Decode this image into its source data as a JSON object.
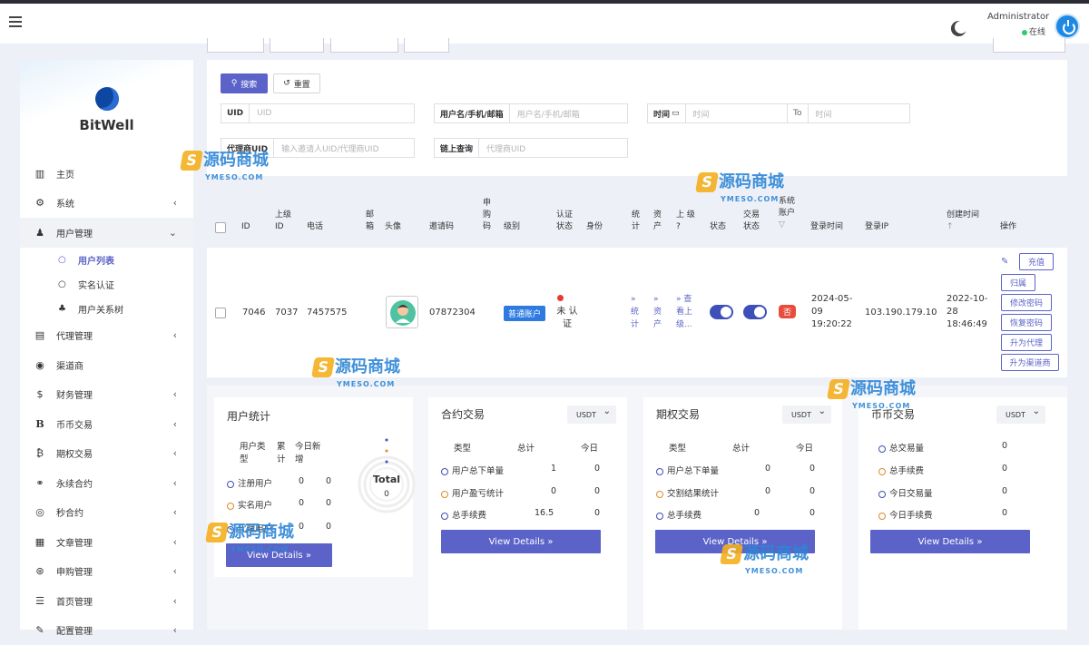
{
  "header": {
    "user": "Administrator",
    "status": "在线"
  },
  "brand": {
    "name": "BitWell"
  },
  "sidebar": {
    "items": [
      {
        "label": "主页",
        "icon": "bar-chart-icon"
      },
      {
        "label": "系统",
        "icon": "gear-icon"
      },
      {
        "label": "用户管理",
        "icon": "users-icon"
      },
      {
        "label": "代理管理",
        "icon": "id-card-icon"
      },
      {
        "label": "渠道商",
        "icon": "user-circle-icon"
      },
      {
        "label": "财务管理",
        "icon": "dollar-icon"
      },
      {
        "label": "币币交易",
        "icon": "bold-b-icon"
      },
      {
        "label": "期权交易",
        "icon": "bitcoin-icon"
      },
      {
        "label": "永续合约",
        "icon": "link-icon"
      },
      {
        "label": "秒合约",
        "icon": "target-icon"
      },
      {
        "label": "文章管理",
        "icon": "newspaper-icon"
      },
      {
        "label": "申购管理",
        "icon": "life-ring-icon"
      },
      {
        "label": "首页管理",
        "icon": "list-icon"
      },
      {
        "label": "配置管理",
        "icon": "wrench-icon"
      }
    ],
    "sub": [
      {
        "label": "用户列表"
      },
      {
        "label": "实名认证"
      },
      {
        "label": "用户关系树"
      }
    ]
  },
  "filters": {
    "search": "搜索",
    "reset": "重置",
    "uid": {
      "label": "UID",
      "placeholder": "UID"
    },
    "user": {
      "label": "用户名/手机/邮箱",
      "placeholder": "用户名/手机/邮箱"
    },
    "time": {
      "label": "时间",
      "from": "时间",
      "to_label": "To",
      "to": "时间"
    },
    "agent": {
      "label": "代理商UID",
      "placeholder": "输入邀请人UID/代理商UID"
    },
    "chain": {
      "label": "链上查询",
      "placeholder": "代理商UID"
    }
  },
  "table": {
    "headers": {
      "id": "ID",
      "parent": "上级 ID",
      "phone": "电话",
      "email": "邮 箱",
      "avatar": "头像",
      "invite": "邀请码",
      "apply": "申 购 码",
      "level": "级别",
      "auth": "认证 状态",
      "identity": "身份",
      "stats": "统 计",
      "assets": "资 产",
      "upper": "上 级",
      "status": "状态",
      "trade": "交易 状态",
      "sys": "系统 账户",
      "login_time": "登录时间",
      "login_ip": "登录IP",
      "created": "创建时间",
      "ops": "操作"
    },
    "row": {
      "id": "7046",
      "parent": "7037",
      "phone": "7457575",
      "invite": "07872304",
      "level": "普通账户",
      "auth": "未 认证",
      "stats": "» 统 计",
      "assets": "» 资 产",
      "upper": "» 查 看上 级...",
      "sys": "否",
      "login_time": "2024-05- 09 19:20:22",
      "login_ip": "103.190.179.10",
      "created": "2022-10- 28 18:46:49",
      "ops": {
        "recharge": "充值",
        "belong": "归属",
        "change_pwd": "修改密码",
        "reset_pwd": "恢复密码",
        "to_agent": "升为代理",
        "to_channel": "升为渠道商"
      }
    }
  },
  "stats": {
    "users": {
      "title": "用户统计",
      "headers": [
        "用户类 型",
        "累 计",
        "今日新 增"
      ],
      "rows": [
        {
          "label": "注册用户",
          "total": "0",
          "today": "0"
        },
        {
          "label": "实名用户",
          "total": "0",
          "today": "0"
        },
        {
          "label": "代理用户",
          "total": "0",
          "today": "0"
        }
      ],
      "ring_label": "Total",
      "ring_value": "0",
      "button": "View Details »"
    },
    "contract": {
      "title": "合约交易",
      "currency": "USDT",
      "headers": [
        "类型",
        "总计",
        "今日"
      ],
      "rows": [
        {
          "label": "用户总下单量",
          "total": "1",
          "today": "0"
        },
        {
          "label": "用户盈亏统计",
          "total": "0",
          "today": "0"
        },
        {
          "label": "总手续费",
          "total": "16.5",
          "today": "0"
        }
      ],
      "button": "View Details »"
    },
    "options": {
      "title": "期权交易",
      "currency": "USDT",
      "headers": [
        "类型",
        "总计",
        "今日"
      ],
      "rows": [
        {
          "label": "用户总下单量",
          "total": "0",
          "today": "0"
        },
        {
          "label": "交割结果统计",
          "total": "0",
          "today": "0"
        },
        {
          "label": "总手续费",
          "total": "0",
          "today": "0"
        }
      ],
      "button": "View Details »"
    },
    "spot": {
      "title": "币币交易",
      "currency": "USDT",
      "rows": [
        {
          "label": "总交易量",
          "total": "0"
        },
        {
          "label": "总手续费",
          "total": "0"
        },
        {
          "label": "今日交易量",
          "total": "0"
        },
        {
          "label": "今日手续费",
          "total": "0"
        }
      ],
      "button": "View Details »"
    }
  },
  "watermark": {
    "text": "源码商城",
    "sub": "YMESO.COM",
    "letter": "S"
  }
}
